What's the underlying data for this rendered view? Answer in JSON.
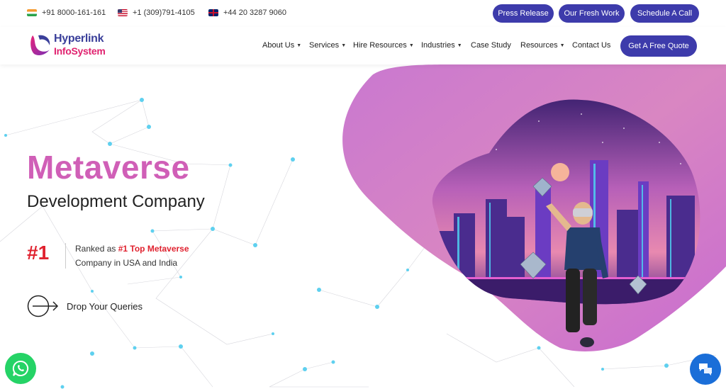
{
  "topbar": {
    "phones": [
      {
        "flag": "india-flag-icon",
        "number": "+91 8000-161-161"
      },
      {
        "flag": "usa-flag-icon",
        "number": "+1 (309)791-4105"
      },
      {
        "flag": "uk-flag-icon",
        "number": "+44 20 3287 9060"
      }
    ],
    "buttons": [
      "Press Release",
      "Our Fresh Work",
      "Schedule A Call"
    ]
  },
  "logo": {
    "line1": "Hyperlink",
    "line2": "InfoSystem"
  },
  "nav": {
    "items": [
      "About Us",
      "Services",
      "Hire Resources",
      "Industries",
      "Case Study",
      "Resources",
      "Contact Us"
    ],
    "quote_button": "Get A Free Quote"
  },
  "hero": {
    "title": "Metaverse",
    "subtitle": "Development Company",
    "rank_number": "#1",
    "rank_prefix": "Ranked as ",
    "rank_highlight": "#1 Top Metaverse",
    "rank_suffix": "Company in USA and India",
    "queries_label": "Drop Your Queries"
  },
  "floating": {
    "whatsapp_icon": "whatsapp-icon",
    "chat_icon": "chat-icon"
  },
  "colors": {
    "accent": "#3d3bab",
    "title_pink": "#d05fb7",
    "highlight_red": "#e0222f",
    "node_blue": "#5ed0ef"
  }
}
